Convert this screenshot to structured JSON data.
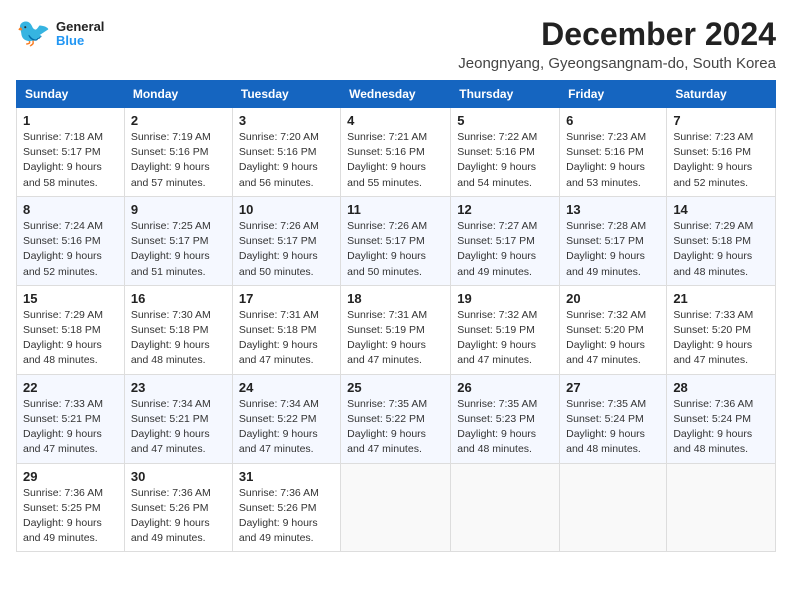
{
  "logo": {
    "general": "General",
    "blue": "Blue"
  },
  "title": "December 2024",
  "subtitle": "Jeongnyang, Gyeongsangnam-do, South Korea",
  "days_of_week": [
    "Sunday",
    "Monday",
    "Tuesday",
    "Wednesday",
    "Thursday",
    "Friday",
    "Saturday"
  ],
  "weeks": [
    [
      {
        "day": "1",
        "sunrise": "Sunrise: 7:18 AM",
        "sunset": "Sunset: 5:17 PM",
        "daylight": "Daylight: 9 hours and 58 minutes."
      },
      {
        "day": "2",
        "sunrise": "Sunrise: 7:19 AM",
        "sunset": "Sunset: 5:16 PM",
        "daylight": "Daylight: 9 hours and 57 minutes."
      },
      {
        "day": "3",
        "sunrise": "Sunrise: 7:20 AM",
        "sunset": "Sunset: 5:16 PM",
        "daylight": "Daylight: 9 hours and 56 minutes."
      },
      {
        "day": "4",
        "sunrise": "Sunrise: 7:21 AM",
        "sunset": "Sunset: 5:16 PM",
        "daylight": "Daylight: 9 hours and 55 minutes."
      },
      {
        "day": "5",
        "sunrise": "Sunrise: 7:22 AM",
        "sunset": "Sunset: 5:16 PM",
        "daylight": "Daylight: 9 hours and 54 minutes."
      },
      {
        "day": "6",
        "sunrise": "Sunrise: 7:23 AM",
        "sunset": "Sunset: 5:16 PM",
        "daylight": "Daylight: 9 hours and 53 minutes."
      },
      {
        "day": "7",
        "sunrise": "Sunrise: 7:23 AM",
        "sunset": "Sunset: 5:16 PM",
        "daylight": "Daylight: 9 hours and 52 minutes."
      }
    ],
    [
      {
        "day": "8",
        "sunrise": "Sunrise: 7:24 AM",
        "sunset": "Sunset: 5:16 PM",
        "daylight": "Daylight: 9 hours and 52 minutes."
      },
      {
        "day": "9",
        "sunrise": "Sunrise: 7:25 AM",
        "sunset": "Sunset: 5:17 PM",
        "daylight": "Daylight: 9 hours and 51 minutes."
      },
      {
        "day": "10",
        "sunrise": "Sunrise: 7:26 AM",
        "sunset": "Sunset: 5:17 PM",
        "daylight": "Daylight: 9 hours and 50 minutes."
      },
      {
        "day": "11",
        "sunrise": "Sunrise: 7:26 AM",
        "sunset": "Sunset: 5:17 PM",
        "daylight": "Daylight: 9 hours and 50 minutes."
      },
      {
        "day": "12",
        "sunrise": "Sunrise: 7:27 AM",
        "sunset": "Sunset: 5:17 PM",
        "daylight": "Daylight: 9 hours and 49 minutes."
      },
      {
        "day": "13",
        "sunrise": "Sunrise: 7:28 AM",
        "sunset": "Sunset: 5:17 PM",
        "daylight": "Daylight: 9 hours and 49 minutes."
      },
      {
        "day": "14",
        "sunrise": "Sunrise: 7:29 AM",
        "sunset": "Sunset: 5:18 PM",
        "daylight": "Daylight: 9 hours and 48 minutes."
      }
    ],
    [
      {
        "day": "15",
        "sunrise": "Sunrise: 7:29 AM",
        "sunset": "Sunset: 5:18 PM",
        "daylight": "Daylight: 9 hours and 48 minutes."
      },
      {
        "day": "16",
        "sunrise": "Sunrise: 7:30 AM",
        "sunset": "Sunset: 5:18 PM",
        "daylight": "Daylight: 9 hours and 48 minutes."
      },
      {
        "day": "17",
        "sunrise": "Sunrise: 7:31 AM",
        "sunset": "Sunset: 5:18 PM",
        "daylight": "Daylight: 9 hours and 47 minutes."
      },
      {
        "day": "18",
        "sunrise": "Sunrise: 7:31 AM",
        "sunset": "Sunset: 5:19 PM",
        "daylight": "Daylight: 9 hours and 47 minutes."
      },
      {
        "day": "19",
        "sunrise": "Sunrise: 7:32 AM",
        "sunset": "Sunset: 5:19 PM",
        "daylight": "Daylight: 9 hours and 47 minutes."
      },
      {
        "day": "20",
        "sunrise": "Sunrise: 7:32 AM",
        "sunset": "Sunset: 5:20 PM",
        "daylight": "Daylight: 9 hours and 47 minutes."
      },
      {
        "day": "21",
        "sunrise": "Sunrise: 7:33 AM",
        "sunset": "Sunset: 5:20 PM",
        "daylight": "Daylight: 9 hours and 47 minutes."
      }
    ],
    [
      {
        "day": "22",
        "sunrise": "Sunrise: 7:33 AM",
        "sunset": "Sunset: 5:21 PM",
        "daylight": "Daylight: 9 hours and 47 minutes."
      },
      {
        "day": "23",
        "sunrise": "Sunrise: 7:34 AM",
        "sunset": "Sunset: 5:21 PM",
        "daylight": "Daylight: 9 hours and 47 minutes."
      },
      {
        "day": "24",
        "sunrise": "Sunrise: 7:34 AM",
        "sunset": "Sunset: 5:22 PM",
        "daylight": "Daylight: 9 hours and 47 minutes."
      },
      {
        "day": "25",
        "sunrise": "Sunrise: 7:35 AM",
        "sunset": "Sunset: 5:22 PM",
        "daylight": "Daylight: 9 hours and 47 minutes."
      },
      {
        "day": "26",
        "sunrise": "Sunrise: 7:35 AM",
        "sunset": "Sunset: 5:23 PM",
        "daylight": "Daylight: 9 hours and 48 minutes."
      },
      {
        "day": "27",
        "sunrise": "Sunrise: 7:35 AM",
        "sunset": "Sunset: 5:24 PM",
        "daylight": "Daylight: 9 hours and 48 minutes."
      },
      {
        "day": "28",
        "sunrise": "Sunrise: 7:36 AM",
        "sunset": "Sunset: 5:24 PM",
        "daylight": "Daylight: 9 hours and 48 minutes."
      }
    ],
    [
      {
        "day": "29",
        "sunrise": "Sunrise: 7:36 AM",
        "sunset": "Sunset: 5:25 PM",
        "daylight": "Daylight: 9 hours and 49 minutes."
      },
      {
        "day": "30",
        "sunrise": "Sunrise: 7:36 AM",
        "sunset": "Sunset: 5:26 PM",
        "daylight": "Daylight: 9 hours and 49 minutes."
      },
      {
        "day": "31",
        "sunrise": "Sunrise: 7:36 AM",
        "sunset": "Sunset: 5:26 PM",
        "daylight": "Daylight: 9 hours and 49 minutes."
      },
      null,
      null,
      null,
      null
    ]
  ]
}
